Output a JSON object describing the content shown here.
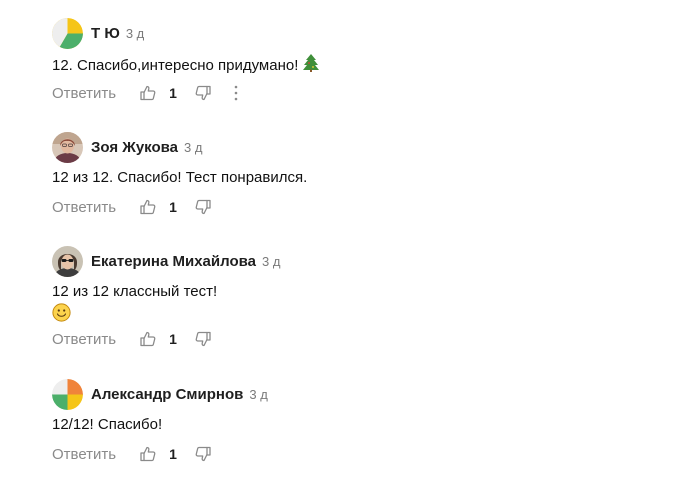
{
  "comments": [
    {
      "author": "Т Ю",
      "time": "3 д",
      "text": "12. Спасибо,интересно придумано!",
      "emoji": "tree-emoji",
      "reply_label": "Ответить",
      "likes": "1",
      "avatar": "pie-avatar-yellow-green"
    },
    {
      "author": "Зоя Жукова",
      "time": "3 д",
      "text": "12 из 12. Спасибо! Тест понравился.",
      "reply_label": "Ответить",
      "likes": "1",
      "avatar": "photo-avatar"
    },
    {
      "author": "Екатерина Михайлова",
      "time": "3 д",
      "text": "12 из 12 классный тест!",
      "emoji": "smile-emoji",
      "reply_label": "Ответить",
      "likes": "1",
      "avatar": "photo-avatar-sunglasses"
    },
    {
      "author": "Александр Смирнов",
      "time": "3 д",
      "text": "12/12! Спасибо!",
      "reply_label": "Ответить",
      "likes": "1",
      "avatar": "pie-avatar-orange-yellow-green"
    }
  ],
  "colors": {
    "muted": "#8a8a8a",
    "green": "#4caf6a",
    "yellow": "#f5c518",
    "orange": "#f0833a"
  }
}
